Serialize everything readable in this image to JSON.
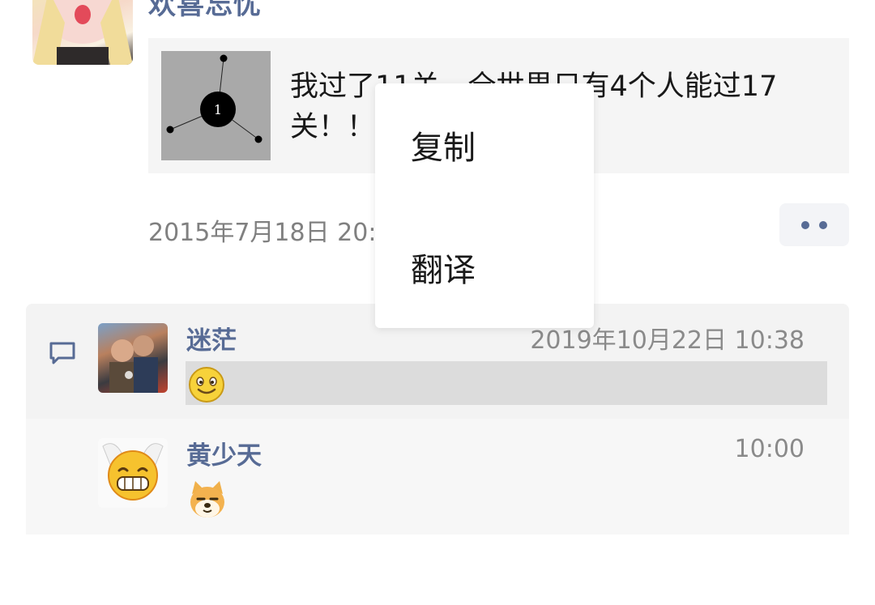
{
  "post": {
    "author": "欢喜忘忧",
    "share_text": "我过了11关，全世界只有4个人能过17关！！",
    "thumb_node_label": "1",
    "time": "2015年7月18日 20:5"
  },
  "comments": [
    {
      "name": "迷茫",
      "time": "2019年10月22日 10:38",
      "emoji": "smile-emoji"
    },
    {
      "name": "黄少天",
      "time": "10:00",
      "emoji": "doge-emoji"
    }
  ],
  "context_menu": {
    "items": [
      {
        "label": "复制"
      },
      {
        "label": "翻译"
      }
    ]
  },
  "colors": {
    "link": "#576b95",
    "card_bg": "#f5f5f5",
    "highlight": "#dcdcdc"
  }
}
